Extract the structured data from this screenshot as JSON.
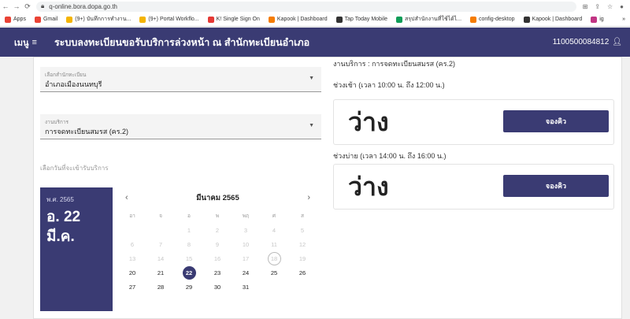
{
  "browser": {
    "back_icon": "arrow-left-icon",
    "forward_icon": "arrow-right-icon",
    "reload_icon": "reload-icon",
    "lock_icon": "lock-icon",
    "url": "q-online.bora.dopa.go.th",
    "bookmarks": [
      {
        "label": "Apps",
        "color": "#e94235"
      },
      {
        "label": "Gmail",
        "color": "#ea4335"
      },
      {
        "label": "(9+) บันทึกการทำงาน...",
        "color": "#f4b400"
      },
      {
        "label": "(9+) Portal Workflo...",
        "color": "#f4b400"
      },
      {
        "label": "K! Single Sign On",
        "color": "#e53935"
      },
      {
        "label": "Kapook | Dashboard",
        "color": "#f57c00"
      },
      {
        "label": "Tap Today Mobile",
        "color": "#333333"
      },
      {
        "label": "สรุปสำนักงานที่ใช้ได้ไ...",
        "color": "#0f9d58"
      },
      {
        "label": "config-desktop",
        "color": "#f57c00"
      },
      {
        "label": "Kapook | Dashboard",
        "color": "#333333"
      },
      {
        "label": "ig",
        "color": "#c13584"
      }
    ],
    "more_label": "»"
  },
  "header": {
    "menu_label": "เมนู",
    "menu_icon": "hamburger-icon",
    "title": "ระบบลงทะเบียนขอรับบริการล่วงหน้า ณ สำนักทะเบียนอำเภอ",
    "user_id": "1100500084812",
    "user_icon": "person-icon"
  },
  "form": {
    "office": {
      "label": "เลือกสำนักทะเบียน",
      "value": "อำเภอเมืองนนทบุรี"
    },
    "service": {
      "label": "งานบริการ",
      "value": "การจดทะเบียนสมรส (คร.2)"
    },
    "date_prompt": "เลือกวันที่จะเข้ารับบริการ"
  },
  "calendar": {
    "year_label": "พ.ศ. 2565",
    "selected_day_line": "อ. 22",
    "selected_month_line": "มี.ค.",
    "month_title": "มีนาคม 2565",
    "weekdays": [
      "อา",
      "จ",
      "อ",
      "พ",
      "พฤ",
      "ศ",
      "ส"
    ],
    "days": [
      [
        "",
        "",
        "1",
        "2",
        "3",
        "4",
        "5"
      ],
      [
        "6",
        "7",
        "8",
        "9",
        "10",
        "11",
        "12"
      ],
      [
        "13",
        "14",
        "15",
        "16",
        "17",
        "18",
        "19"
      ],
      [
        "20",
        "21",
        "22",
        "23",
        "24",
        "25",
        "26"
      ],
      [
        "27",
        "28",
        "29",
        "30",
        "31",
        "",
        ""
      ]
    ],
    "first_enabled_day": 20,
    "today": 18,
    "selected": 22
  },
  "service_panel": {
    "service_name": "งานบริการ : การจดทะเบียนสมรส (คร.2)",
    "slots": [
      {
        "title": "ช่วงเช้า (เวลา 10:00 น. ถึง 12:00 น.)",
        "status": "ว่าง",
        "button": "จองคิว"
      },
      {
        "title": "ช่วงบ่าย (เวลา 14:00 น. ถึง 16:00 น.)",
        "status": "ว่าง",
        "button": "จองคิว"
      }
    ]
  }
}
